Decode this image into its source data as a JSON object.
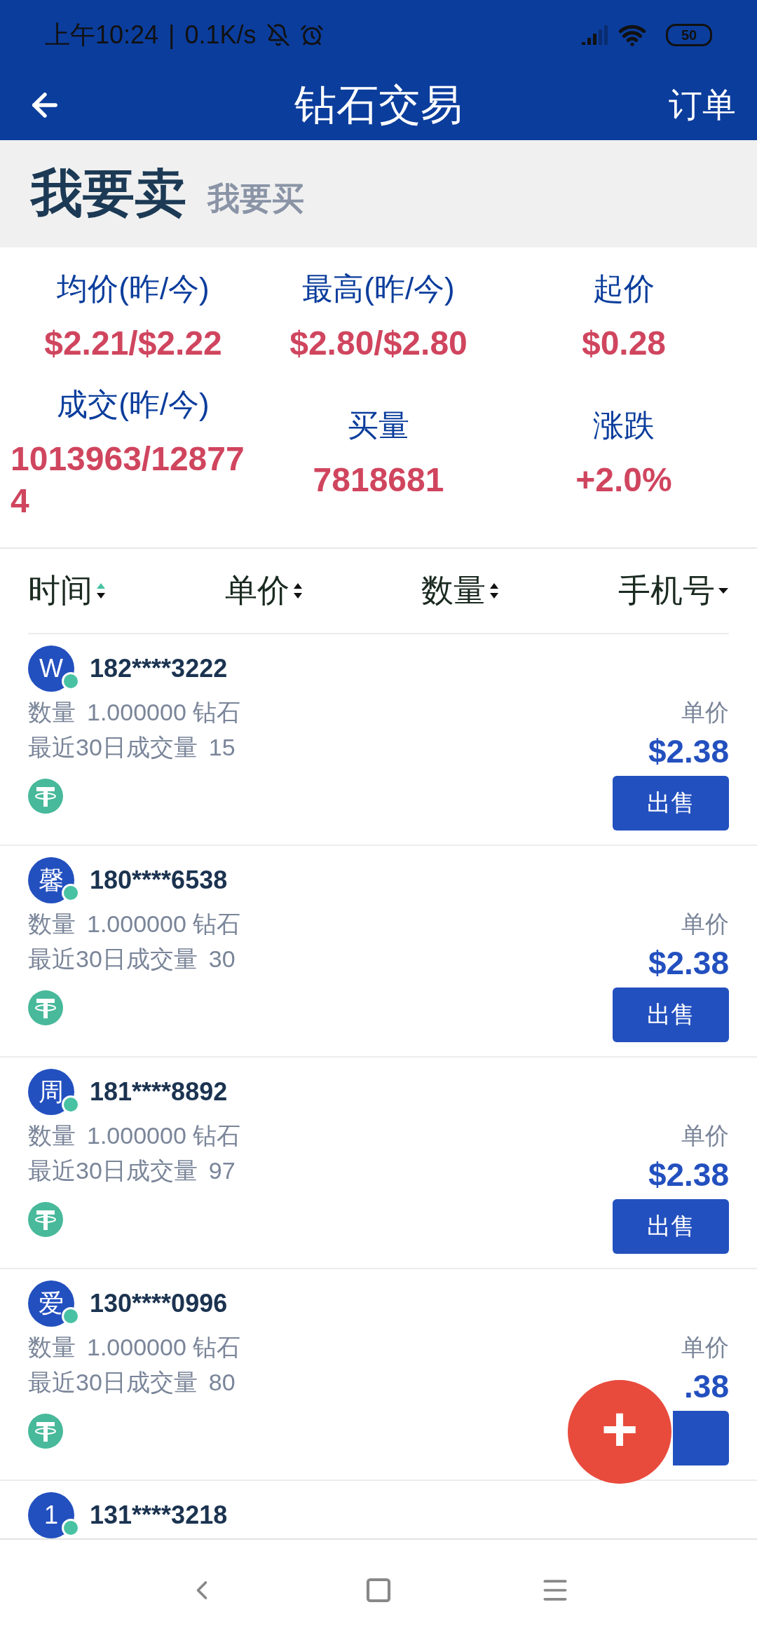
{
  "status_bar": {
    "time": "上午10:24",
    "separator": "|",
    "speed": "0.1K/s",
    "battery": "50"
  },
  "app_bar": {
    "title": "钻石交易",
    "action": "订单"
  },
  "mode_tabs": [
    {
      "label": "我要卖",
      "selected": true
    },
    {
      "label": "我要买",
      "selected": false
    }
  ],
  "stats": [
    {
      "label": "均价(昨/今)",
      "value": "$2.21/$2.22"
    },
    {
      "label": "最高(昨/今)",
      "value": "$2.80/$2.80"
    },
    {
      "label": "起价",
      "value": "$0.28"
    },
    {
      "label": "成交(昨/今)",
      "value": "1013963/128774"
    },
    {
      "label": "买量",
      "value": "7818681"
    },
    {
      "label": "涨跌",
      "value": "+2.0%"
    }
  ],
  "sort_columns": [
    {
      "label": "时间",
      "kind": "sort",
      "sorted_ascending": true
    },
    {
      "label": "单价",
      "kind": "sort",
      "sorted_ascending": false
    },
    {
      "label": "数量",
      "kind": "sort",
      "sorted_ascending": false
    },
    {
      "label": "手机号",
      "kind": "dropdown"
    }
  ],
  "listings": [
    {
      "avatar": "W",
      "online": true,
      "phone": "182****3222",
      "quantity_label": "数量",
      "quantity": "1.000000 钻石",
      "volume_label": "最近30日成交量",
      "volume": "15",
      "price_label": "单价",
      "price": "$2.38",
      "action": "出售"
    },
    {
      "avatar": "馨",
      "online": true,
      "phone": "180****6538",
      "quantity_label": "数量",
      "quantity": "1.000000 钻石",
      "volume_label": "最近30日成交量",
      "volume": "30",
      "price_label": "单价",
      "price": "$2.38",
      "action": "出售"
    },
    {
      "avatar": "周",
      "online": true,
      "phone": "181****8892",
      "quantity_label": "数量",
      "quantity": "1.000000 钻石",
      "volume_label": "最近30日成交量",
      "volume": "97",
      "price_label": "单价",
      "price": "$2.38",
      "action": "出售"
    },
    {
      "avatar": "爱",
      "online": true,
      "phone": "130****0996",
      "quantity_label": "数量",
      "quantity": "1.000000 钻石",
      "volume_label": "最近30日成交量",
      "volume": "80",
      "price_label": "单价",
      "price": ".38"
    },
    {
      "avatar": "1",
      "online": true,
      "phone": "131****3218"
    }
  ],
  "fab": {
    "label": "+"
  }
}
